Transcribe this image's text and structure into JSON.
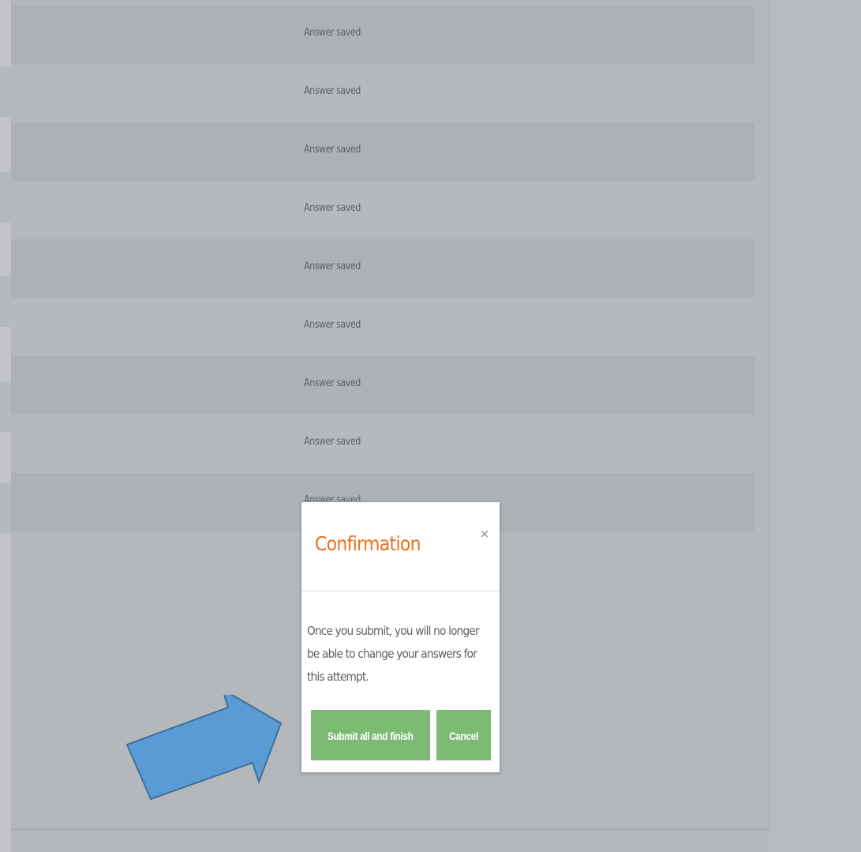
{
  "summary": {
    "rows": [
      {
        "status": "Answer saved"
      },
      {
        "status": "Answer saved"
      },
      {
        "status": "Answer saved"
      },
      {
        "status": "Answer saved"
      },
      {
        "status": "Answer saved"
      },
      {
        "status": "Answer saved"
      },
      {
        "status": "Answer saved"
      },
      {
        "status": "Answer saved"
      },
      {
        "status": "Answer saved"
      }
    ]
  },
  "modal": {
    "title": "Confirmation",
    "close_label": "×",
    "message_lines": [
      "Once you submit, you will no longer",
      "be able to change your answers for",
      "this attempt."
    ],
    "submit_label": "Submit all and finish",
    "cancel_label": "Cancel"
  },
  "colors": {
    "title_accent": "#e8711c",
    "button_green": "#7dbb75",
    "arrow_blue": "#5b9bd5",
    "overlay_gray": "#b4b8bb"
  },
  "annotation": {
    "icon": "arrow-pointer-icon"
  }
}
